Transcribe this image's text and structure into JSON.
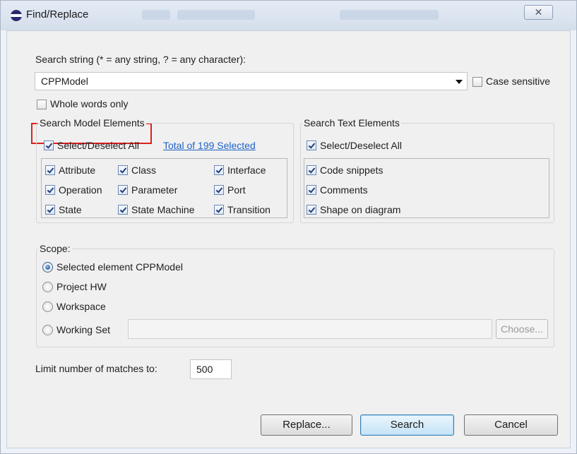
{
  "window": {
    "title": "Find/Replace",
    "close_glyph": "✕"
  },
  "search": {
    "label": "Search string (* = any string, ? = any character):",
    "value": "CPPModel",
    "case_sensitive_label": "Case sensitive",
    "case_sensitive_checked": false,
    "whole_words_label": "Whole words only",
    "whole_words_checked": false
  },
  "model_elements": {
    "title": "Search Model Elements",
    "select_all_label": "Select/Deselect All",
    "select_all_checked": true,
    "total_link": "Total of 199 Selected",
    "items": [
      {
        "label": "Attribute",
        "checked": true
      },
      {
        "label": "Class",
        "checked": true
      },
      {
        "label": "Interface",
        "checked": true
      },
      {
        "label": "Operation",
        "checked": true
      },
      {
        "label": "Parameter",
        "checked": true
      },
      {
        "label": "Port",
        "checked": true
      },
      {
        "label": "State",
        "checked": true
      },
      {
        "label": "State Machine",
        "checked": true
      },
      {
        "label": "Transition",
        "checked": true
      }
    ]
  },
  "text_elements": {
    "title": "Search Text Elements",
    "select_all_label": "Select/Deselect All",
    "select_all_checked": true,
    "items": [
      {
        "label": "Code snippets",
        "checked": true
      },
      {
        "label": "Comments",
        "checked": true
      },
      {
        "label": "Shape on diagram",
        "checked": true
      }
    ]
  },
  "scope": {
    "title": "Scope:",
    "options": [
      {
        "label": "Selected element CPPModel",
        "selected": true
      },
      {
        "label": "Project HW",
        "selected": false
      },
      {
        "label": "Workspace",
        "selected": false
      },
      {
        "label": "Working Set",
        "selected": false
      }
    ],
    "working_set_value": "",
    "choose_label": "Choose..."
  },
  "limit": {
    "label": "Limit number of matches to:",
    "value": "500"
  },
  "buttons": {
    "replace": "Replace...",
    "search": "Search",
    "cancel": "Cancel"
  },
  "colors": {
    "highlight_border": "#e0201b",
    "link": "#1e62c8",
    "default_button": "#3c7fb1"
  }
}
